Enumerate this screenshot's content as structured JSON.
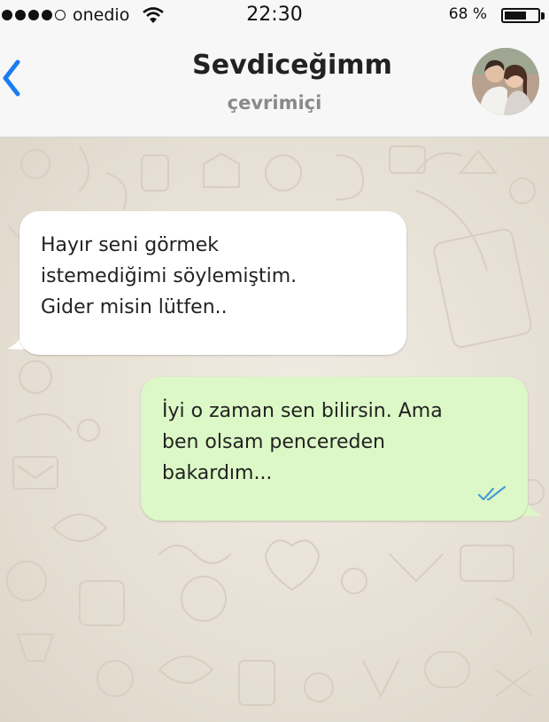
{
  "status_bar": {
    "carrier": "onedio",
    "time": "22:30",
    "battery_percent": "68 %",
    "battery_level": 0.68,
    "signal_bars": 4,
    "signal_max": 5,
    "wifi_icon": "wifi-icon"
  },
  "header": {
    "back_icon": "chevron-left-icon",
    "contact_name": "Sevdiceğimm",
    "status": "çevrimiçi",
    "avatar": "contact-avatar"
  },
  "messages": [
    {
      "direction": "incoming",
      "lines": [
        "Hayır seni görmek",
        "istemediğimi söylemiştim.",
        "Gider misin lütfen.."
      ]
    },
    {
      "direction": "outgoing",
      "lines": [
        "İyi o zaman sen bilirsin. Ama",
        "ben olsam pencereden",
        "bakardım..."
      ],
      "read_receipt_icon": "double-check-icon"
    }
  ],
  "colors": {
    "accent": "#1a7cf3",
    "outgoing_bubble": "#dcf8c6",
    "incoming_bubble": "#ffffff",
    "read_check": "#4a9bd5"
  }
}
